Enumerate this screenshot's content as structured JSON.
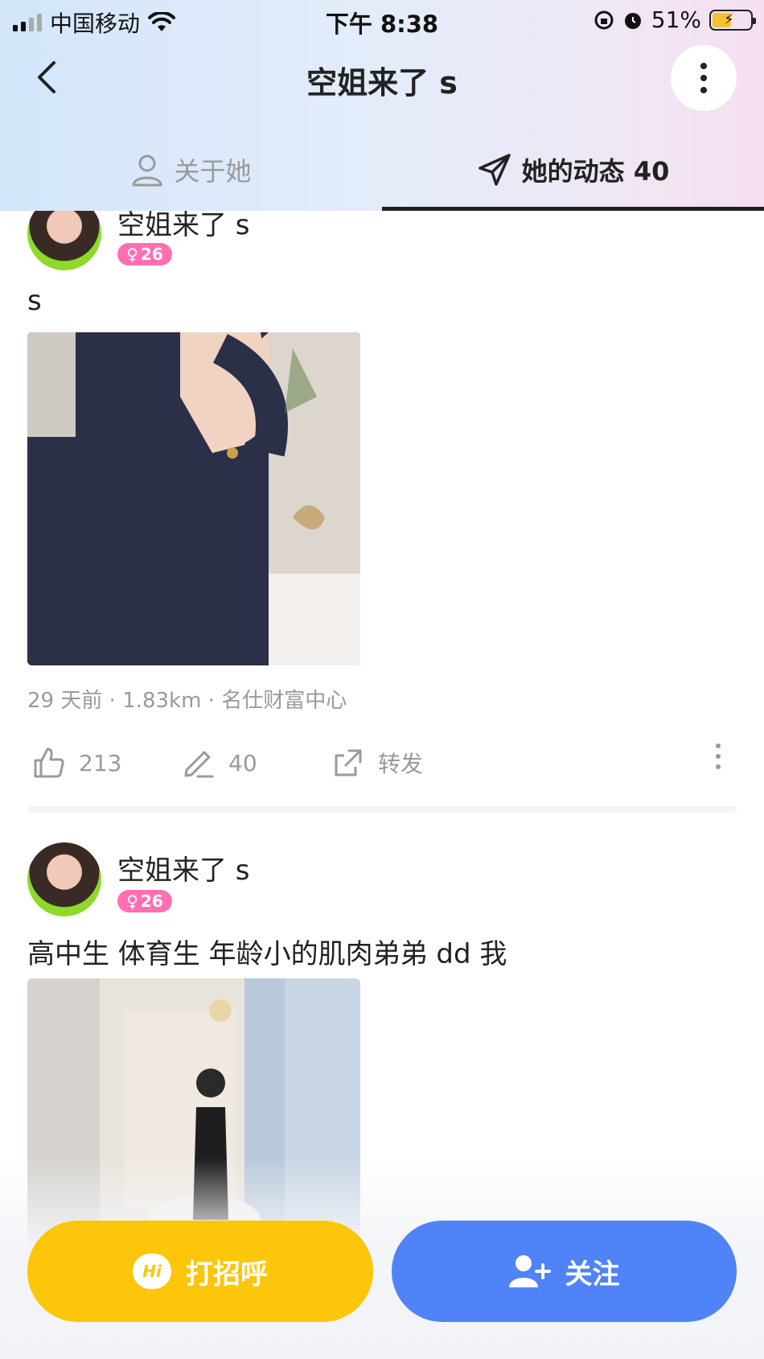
{
  "status_bar": {
    "carrier": "中国移动",
    "time": "下午 8:38",
    "battery": "51%"
  },
  "nav": {
    "title": "空姐来了 s"
  },
  "tabs": [
    {
      "label": "关于她"
    },
    {
      "label": "她的动态 40"
    }
  ],
  "posts": [
    {
      "username": "空姐来了 s",
      "age": "26",
      "text": "s",
      "meta": "29 天前 · 1.83km · 名仕财富中心",
      "likes": "213",
      "comments": "40",
      "share_label": "转发"
    },
    {
      "username": "空姐来了 s",
      "age": "26",
      "text": "高中生 体育生 年龄小的肌肉弟弟 dd 我"
    }
  ],
  "buttons": {
    "greet_label": "打招呼",
    "greet_icon_text": "Hi",
    "follow_label": "关注"
  },
  "colors": {
    "greet": "#fdc60a",
    "follow": "#4f83f7",
    "gender_badge": "#ff6fb2"
  }
}
